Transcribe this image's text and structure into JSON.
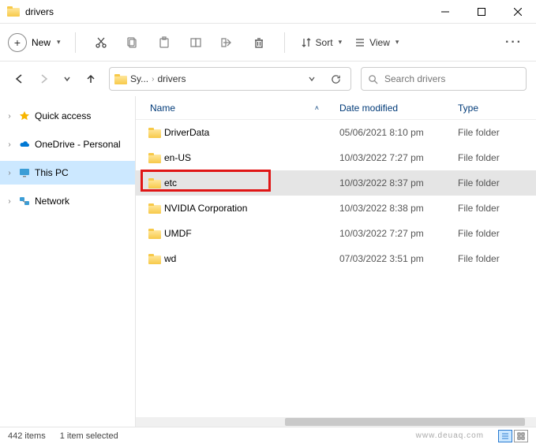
{
  "window": {
    "title": "drivers"
  },
  "toolbar": {
    "new_label": "New",
    "sort_label": "Sort",
    "view_label": "View"
  },
  "breadcrumb": {
    "segment1": "Sy...",
    "segment2": "drivers"
  },
  "search": {
    "placeholder": "Search drivers"
  },
  "sidebar": {
    "items": [
      {
        "label": "Quick access"
      },
      {
        "label": "OneDrive - Personal"
      },
      {
        "label": "This PC"
      },
      {
        "label": "Network"
      }
    ]
  },
  "columns": {
    "name": "Name",
    "date": "Date modified",
    "type": "Type"
  },
  "rows": [
    {
      "name": "DriverData",
      "date": "05/06/2021 8:10 pm",
      "type": "File folder"
    },
    {
      "name": "en-US",
      "date": "10/03/2022 7:27 pm",
      "type": "File folder"
    },
    {
      "name": "etc",
      "date": "10/03/2022 8:37 pm",
      "type": "File folder"
    },
    {
      "name": "NVIDIA Corporation",
      "date": "10/03/2022 8:38 pm",
      "type": "File folder"
    },
    {
      "name": "UMDF",
      "date": "10/03/2022 7:27 pm",
      "type": "File folder"
    },
    {
      "name": "wd",
      "date": "07/03/2022 3:51 pm",
      "type": "File folder"
    }
  ],
  "status": {
    "item_count": "442 items",
    "selection": "1 item selected"
  },
  "watermark": "www.deuaq.com"
}
